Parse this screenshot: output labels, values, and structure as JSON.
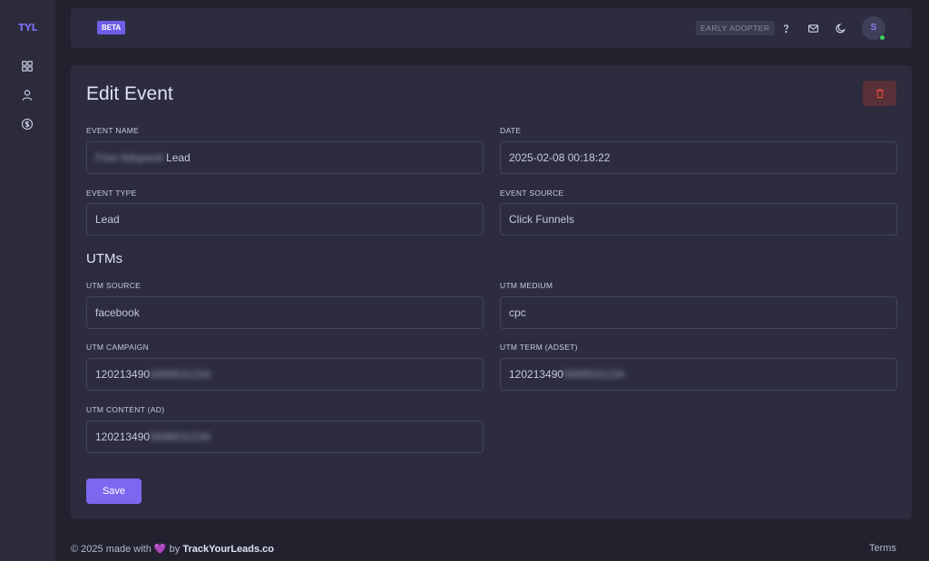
{
  "sidebar": {
    "logo": "TYL",
    "items": [
      {
        "icon": "grid-icon"
      },
      {
        "icon": "user-icon"
      },
      {
        "icon": "dollar-circle-icon"
      }
    ]
  },
  "topbar": {
    "beta_badge": "BETA",
    "early_adopter_badge": "EARLY ADOPTER",
    "help_icon": "question-icon",
    "mail_icon": "mail-icon",
    "theme_icon": "moon-icon",
    "avatar_initial": "S",
    "online_status_color": "#3ecf62"
  },
  "page": {
    "title": "Edit Event",
    "delete_icon": "trash-icon",
    "fields": {
      "event_name": {
        "label": "EVENT NAME",
        "value_blurred": "Free Adspend",
        "value": "Lead"
      },
      "date": {
        "label": "DATE",
        "value": "2025-02-08 00:18:22"
      },
      "event_type": {
        "label": "EVENT TYPE",
        "value": "Lead"
      },
      "event_source": {
        "label": "EVENT SOURCE",
        "value": "Click Funnels"
      }
    },
    "utm_section_title": "UTMs",
    "utm_fields": {
      "source": {
        "label": "UTM SOURCE",
        "value": "facebook"
      },
      "medium": {
        "label": "UTM MEDIUM",
        "value": "cpc"
      },
      "campaign": {
        "label": "UTM CAMPAIGN",
        "value": "120213490",
        "value_blurred": "5698531234"
      },
      "term": {
        "label": "UTM TERM (ADSET)",
        "value": "120213490",
        "value_blurred": "5698531234"
      },
      "content": {
        "label": "UTM CONTENT (AD)",
        "value": "120213490",
        "value_blurred": "5698531234"
      }
    },
    "save_label": "Save"
  },
  "footer": {
    "prefix": "© 2025 made with",
    "heart": "💜",
    "by": "by",
    "brand": "TrackYourLeads.co",
    "terms": "Terms"
  },
  "colors": {
    "accent": "#7b68ee",
    "background": "#22222f",
    "card": "#2c2c3e",
    "danger": "#e0493d"
  }
}
